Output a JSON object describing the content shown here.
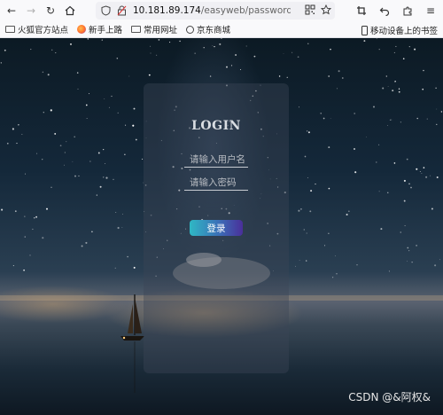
{
  "browser": {
    "url_host": "10.181.89.174",
    "url_path": "/easyweb/password.php/log"
  },
  "bookmarks": [
    {
      "label": "火狐官方站点",
      "icon": "folder-icon"
    },
    {
      "label": "新手上路",
      "icon": "firefox-icon"
    },
    {
      "label": "常用网址",
      "icon": "folder-icon"
    },
    {
      "label": "京东商城",
      "icon": "globe-icon"
    }
  ],
  "mobile_bookmarks": "移动设备上的书签",
  "login": {
    "title": "LOGIN",
    "username_placeholder": "请输入用户名",
    "password_placeholder": "请输入密码",
    "button_label": "登录"
  },
  "watermark": "CSDN @&阿权&"
}
